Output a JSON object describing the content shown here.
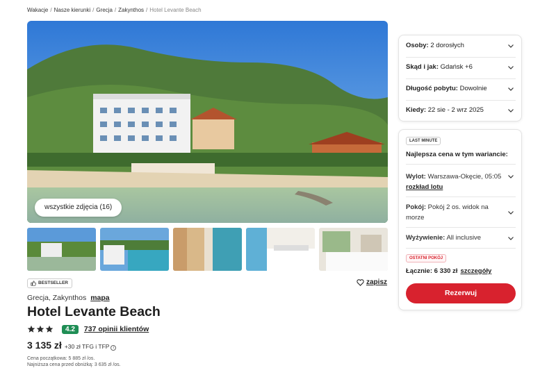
{
  "breadcrumb": {
    "items": [
      "Wakacje",
      "Nasze kierunki",
      "Grecja",
      "Zakynthos"
    ],
    "current": "Hotel Levante Beach"
  },
  "gallery": {
    "all_photos_label": "wszystkie zdjęcia (16)",
    "thumbnails": [
      "thumb-1",
      "thumb-2",
      "thumb-3",
      "thumb-4",
      "thumb-5"
    ]
  },
  "hotel": {
    "badge": "BESTSELLER",
    "save_label": "zapisz",
    "location": "Grecja, Zakynthos",
    "map_label": "mapa",
    "name": "Hotel Levante Beach",
    "stars": 3,
    "score": "4.2",
    "reviews": "737 opinii klientów",
    "price": "3 135 zł",
    "price_extra": "+30 zł TFG i TFP",
    "start_price_note": "Cena początkowa: 5 885 zł /os.",
    "lowest_price_note": "Najniższa cena przed obniżką: 3 635 zł /os."
  },
  "search": {
    "persons_label": "Osoby:",
    "persons_value": "2 dorosłych",
    "from_label": "Skąd i jak:",
    "from_value": "Gdańsk +6",
    "duration_label": "Długość pobytu:",
    "duration_value": "Dowolnie",
    "when_label": "Kiedy:",
    "when_value": "22 sie - 2 wrz 2025"
  },
  "offer": {
    "badge": "LAST MINUTE",
    "best_price": "Najlepsza cena w tym wariancie:",
    "flight_label": "Wylot:",
    "flight_value": "Warszawa-Okęcie, 05:05",
    "flight_link": "rozkład lotu",
    "room_label": "Pokój:",
    "room_value": "Pokój 2 os. widok na morze",
    "board_label": "Wyżywienie:",
    "board_value": "All inclusive",
    "last_room_badge": "OSTATNI POKÓJ",
    "total_label": "Łącznie: 6 330 zł",
    "details_link": "szczegóły",
    "reserve_button": "Rezerwuj"
  },
  "colors": {
    "accent": "#d8222e",
    "score_bg": "#1f8e55"
  }
}
